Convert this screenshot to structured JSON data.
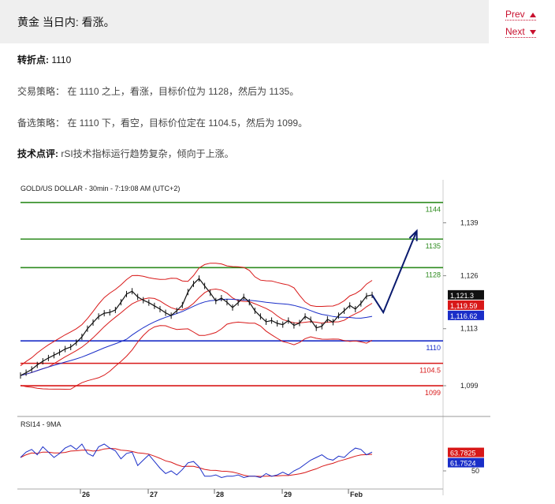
{
  "header": {
    "title": "黄金 当日内: 看涨。"
  },
  "nav": {
    "prev_label": "Prev",
    "next_label": "Next",
    "prev_icon": "triangle-up-icon",
    "next_icon": "triangle-down-icon"
  },
  "content": {
    "pivot_label": "转折点:",
    "pivot_value": " 1110",
    "strategy": "交易策略： 在 1110 之上，看涨，目标价位为 1128，然后为 1135。",
    "alternative": "备选策略： 在 1110 下，看空，目标价位定在 1104.5，然后为 1099。",
    "comment_label": "技术点评:",
    "comment_text": " rSI技术指标运行趋势复杂，倾向于上涨。"
  },
  "colors": {
    "accent": "#c8102e",
    "green": "#2e8b1f",
    "blue": "#1a2ec8",
    "red": "#d81818",
    "navy": "#0a1a6e"
  },
  "chart_data": {
    "type": "line",
    "title": "GOLD/US DOLLAR - 30min - 7:19:08 AM (UTC+2)",
    "ylim": [
      1093,
      1148
    ],
    "yticks": [
      1099,
      1113,
      1126,
      1139
    ],
    "ytick_labels": [
      "1,099",
      "1,113",
      "1,126",
      "1,139"
    ],
    "levels": [
      {
        "value": 1144,
        "label": "1144",
        "color": "#2e8b1f"
      },
      {
        "value": 1135,
        "label": "1135",
        "color": "#2e8b1f"
      },
      {
        "value": 1128,
        "label": "1128",
        "color": "#2e8b1f"
      },
      {
        "value": 1110,
        "label": "1110",
        "color": "#1a2ec8"
      },
      {
        "value": 1104.5,
        "label": "1104.5",
        "color": "#d81818"
      },
      {
        "value": 1099,
        "label": "1099",
        "color": "#d81818"
      }
    ],
    "price_tags": [
      {
        "value": 1121.3,
        "label": "1,121.3",
        "bg": "#111111"
      },
      {
        "value": 1119.0,
        "label": "1,119.59",
        "bg": "#d81818"
      },
      {
        "value": 1116.62,
        "label": "1,116.62",
        "bg": "#1a2ec8"
      }
    ],
    "x_labels": [
      "26",
      "27",
      "28",
      "29",
      "Feb"
    ],
    "price": [
      1101.5,
      1102.2,
      1103.0,
      1104.1,
      1105.0,
      1105.8,
      1106.5,
      1107.2,
      1108.0,
      1108.5,
      1109.6,
      1111.0,
      1113.0,
      1114.5,
      1116.0,
      1116.8,
      1117.0,
      1117.6,
      1119.5,
      1121.5,
      1122.2,
      1120.8,
      1120.0,
      1119.4,
      1118.6,
      1117.8,
      1116.9,
      1116.2,
      1117.4,
      1118.8,
      1122.0,
      1124.0,
      1125.3,
      1123.5,
      1121.8,
      1119.8,
      1120.5,
      1119.5,
      1118.2,
      1119.4,
      1120.8,
      1119.5,
      1117.4,
      1116.0,
      1114.7,
      1115.0,
      1114.3,
      1114.0,
      1115.0,
      1113.8,
      1114.4,
      1116.0,
      1115.2,
      1113.2,
      1113.6,
      1115.3,
      1114.6,
      1116.2,
      1117.4,
      1118.7,
      1117.8,
      1119.2,
      1121.0,
      1121.3
    ],
    "projection": [
      [
        1121.3,
        0
      ],
      [
        1117.0,
        2
      ],
      [
        1137.0,
        8
      ]
    ],
    "rsi": {
      "label": "RSI14 - 9MA",
      "ylim": [
        40,
        80
      ],
      "yticks": [
        50
      ],
      "tags": [
        {
          "value": 63.7825,
          "label": "63.7825",
          "bg": "#d81818"
        },
        {
          "value": 61.7524,
          "label": "61.7524",
          "bg": "#1a2ec8"
        }
      ],
      "values": [
        60,
        64,
        66,
        62,
        68,
        64,
        60,
        63,
        67,
        69,
        66,
        70,
        63,
        61,
        68,
        70,
        67,
        65,
        59,
        63,
        64,
        54,
        58,
        62,
        57,
        52,
        48,
        50,
        47,
        51,
        56,
        57,
        53,
        46,
        46,
        47,
        45,
        46,
        46,
        47,
        45,
        46,
        46,
        45,
        48,
        46,
        47,
        49,
        47,
        50,
        52,
        55,
        58,
        60,
        62,
        59,
        58,
        61,
        60,
        64,
        67,
        66,
        62,
        64
      ]
    }
  }
}
